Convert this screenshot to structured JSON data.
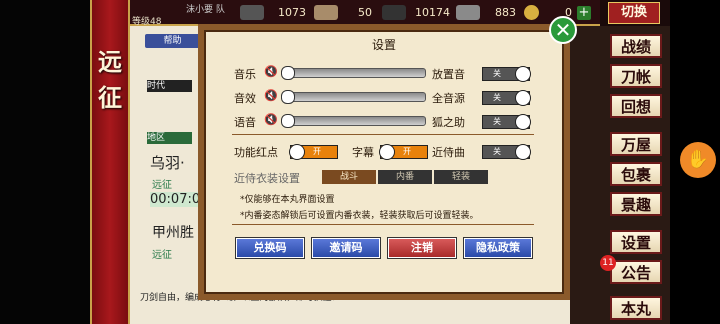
{
  "left_banner": {
    "chars": [
      "远",
      "征"
    ]
  },
  "top_bar": {
    "player_name": "沫小要 队",
    "level": "等级48",
    "resources": [
      {
        "icon": "charcoal-icon",
        "value": "1073"
      },
      {
        "icon": "steel-icon",
        "value": "50"
      },
      {
        "icon": "cooling-material-icon",
        "value": "10174"
      },
      {
        "icon": "whetstone-icon",
        "value": "883"
      },
      {
        "icon": "koban-gold-icon",
        "value": "0"
      }
    ],
    "switch_label": "切换"
  },
  "background": {
    "help_label": "帮助",
    "era_label": "时代",
    "area_label": "地区",
    "area1_name": "乌羽·",
    "area1_sub": "远征",
    "timer": "00:07:0",
    "area2_name": "甲州胜",
    "area2_sub": "远征",
    "footer_msg": "刀剑自由，编成必有6级5以上的部队，即可获胜！"
  },
  "right_menu": {
    "items": [
      "战绩",
      "刀帐",
      "回想",
      "万屋",
      "包裹",
      "景趣",
      "设置",
      "公告",
      "本丸"
    ],
    "notice_count": "11"
  },
  "dialog": {
    "title": "设置",
    "bgm_label": "音乐",
    "bgm_level": 0,
    "se_label": "音效",
    "se_level": 0,
    "voice_label": "语音",
    "voice_level": 0,
    "idle_voice_label": "放置音",
    "idle_voice_state": "关",
    "all_sound_label": "全音源",
    "all_sound_state": "关",
    "fox_help_label": "狐之助",
    "fox_help_state": "关",
    "red_dot_label": "功能红点",
    "red_dot_state": "开",
    "subtitle_label": "字幕",
    "subtitle_state": "开",
    "attendant_song_label": "近侍曲",
    "attendant_song_state": "关",
    "costume_label": "近侍衣装设置",
    "costume_options": [
      "战斗",
      "内番",
      "轻装"
    ],
    "note1": "*仅能够在本丸界面设置",
    "note2": "*内番姿态解锁后可设置内番衣装，轻装获取后可设置轻装。",
    "buttons": {
      "redeem": "兑换码",
      "invite": "邀请码",
      "logout": "注销",
      "privacy": "隐私政策"
    }
  },
  "colors": {
    "toggle_on": "#e8820c",
    "toggle_off": "#555555",
    "dialog_border": "#8b5a2b"
  }
}
